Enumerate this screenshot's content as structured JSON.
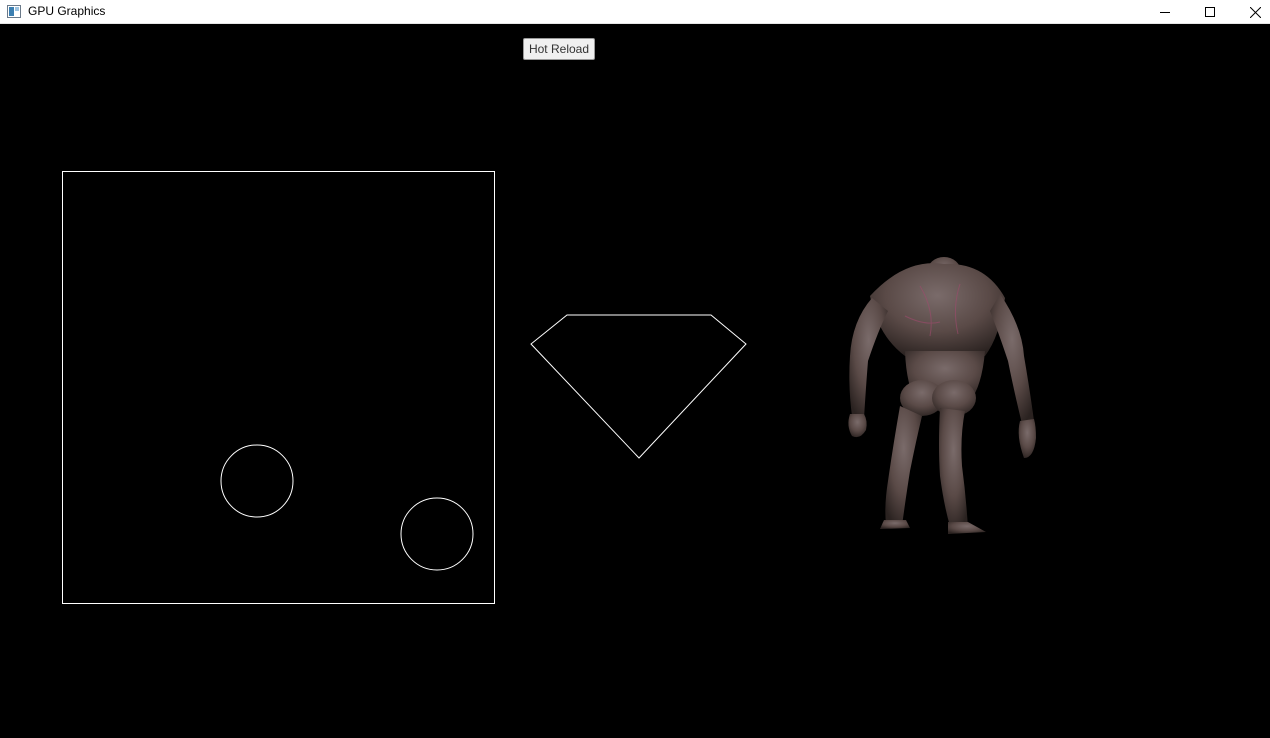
{
  "window": {
    "title": "GPU Graphics",
    "icon": "app-window-icon",
    "controls": [
      "minimize-icon",
      "maximize-icon",
      "close-icon"
    ]
  },
  "toolbar": {
    "hot_reload_label": "Hot Reload"
  },
  "scene": {
    "background_color": "#000000",
    "line_color": "#ffffff",
    "shapes": [
      "square-outline",
      "circle-outline",
      "circle-outline",
      "diamond-outline",
      "humanoid-creature-model"
    ]
  }
}
